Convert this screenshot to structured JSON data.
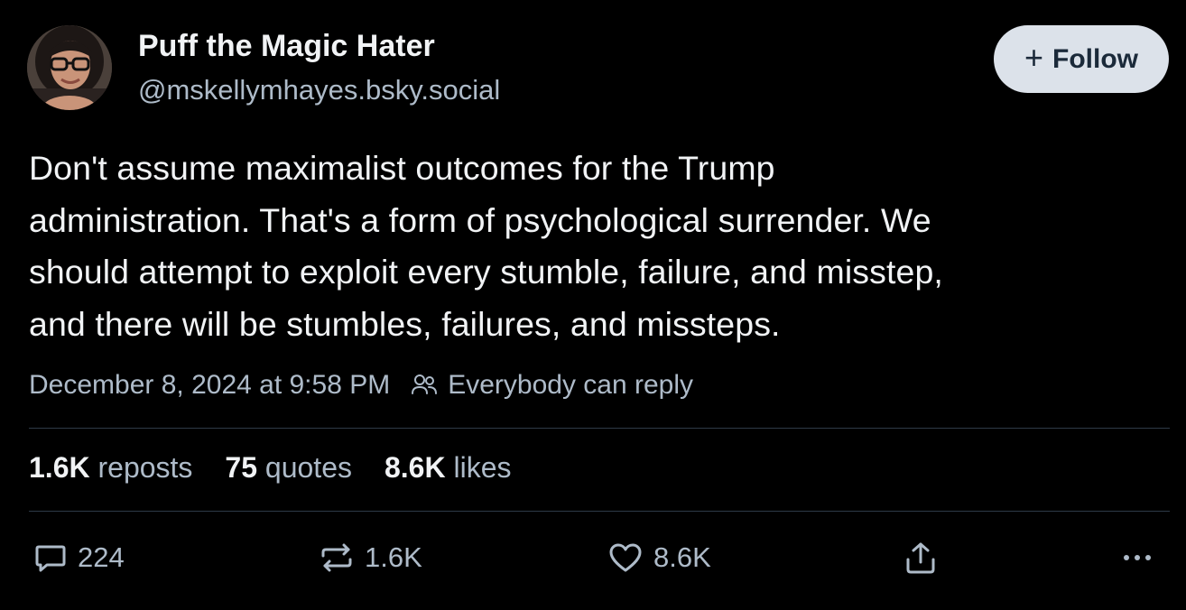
{
  "author": {
    "display_name": "Puff the Magic Hater",
    "handle": "@mskellymhayes.bsky.social"
  },
  "follow_button": {
    "label": "Follow",
    "icon": "plus-icon"
  },
  "post": {
    "lines": [
      "Don't assume maximalist outcomes for the Trump",
      "administration. That's a form of psychological surrender. We",
      "should attempt to exploit every stumble, failure, and misstep,",
      "and there will be stumbles, failures, and missteps."
    ],
    "timestamp": "December 8, 2024 at 9:58 PM",
    "reply_setting": "Everybody can reply"
  },
  "stats": {
    "reposts": {
      "count": "1.6K",
      "label": "reposts"
    },
    "quotes": {
      "count": "75",
      "label": "quotes"
    },
    "likes": {
      "count": "8.6K",
      "label": "likes"
    }
  },
  "actions": {
    "reply_count": "224",
    "repost_count": "1.6K",
    "like_count": "8.6K"
  },
  "colors": {
    "background": "#000000",
    "text_primary": "#f1f3f5",
    "text_secondary": "#aebbc9",
    "divider": "#2e3a47",
    "follow_button_bg": "#dce2ea",
    "follow_button_text": "#1b2a3a"
  }
}
